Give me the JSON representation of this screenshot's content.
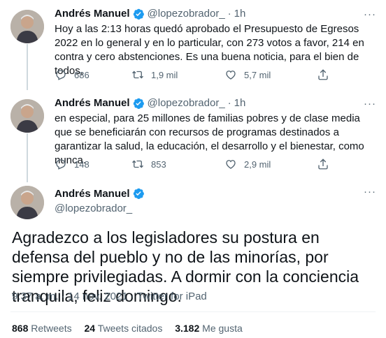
{
  "tweets": [
    {
      "name": "Andrés Manuel",
      "handle": "@lopezobrador_",
      "time": "1h",
      "text": "Hoy a las 2:13 horas quedó aprobado el Presupuesto de Egresos 2022 en lo general y en lo particular, con 273 votos a favor, 214 en contra y cero abstenciones. Es una buena noticia, para el bien de todos,",
      "replies": "686",
      "retweets": "1,9 mil",
      "likes": "5,7 mil"
    },
    {
      "name": "Andrés Manuel",
      "handle": "@lopezobrador_",
      "time": "1h",
      "text": "en especial, para 25 millones de familias pobres y de clase media que se beneficiarán con recursos de programas destinados a garantizar la salud, la educación, el desarrollo y el bienestar, como nunca.",
      "replies": "148",
      "retweets": "853",
      "likes": "2,9 mil"
    }
  ],
  "main_tweet": {
    "name": "Andrés Manuel",
    "handle": "@lopezobrador_",
    "text": "Agradezco a los legisladores su postura en defensa del pueblo y no de las minorías, por siempre privilegiadas. A dormir con la conciencia tranquila, feliz domingo.",
    "meta": "9:37 a. m. · 14 nov. 2021 · Twitter for iPad",
    "stats": {
      "retweets_count": "868",
      "retweets_label": "Retweets",
      "quotes_count": "24",
      "quotes_label": "Tweets citados",
      "likes_count": "3.182",
      "likes_label": "Me gusta"
    }
  },
  "separators": {
    "dot": "·",
    "more": "···"
  },
  "colors": {
    "verified": "#1d9bf0",
    "secondary_text": "#536471",
    "primary_text": "#0f1419"
  },
  "icons": [
    "verified-badge-icon",
    "reply-icon",
    "retweet-icon",
    "like-icon",
    "share-icon",
    "more-icon"
  ]
}
